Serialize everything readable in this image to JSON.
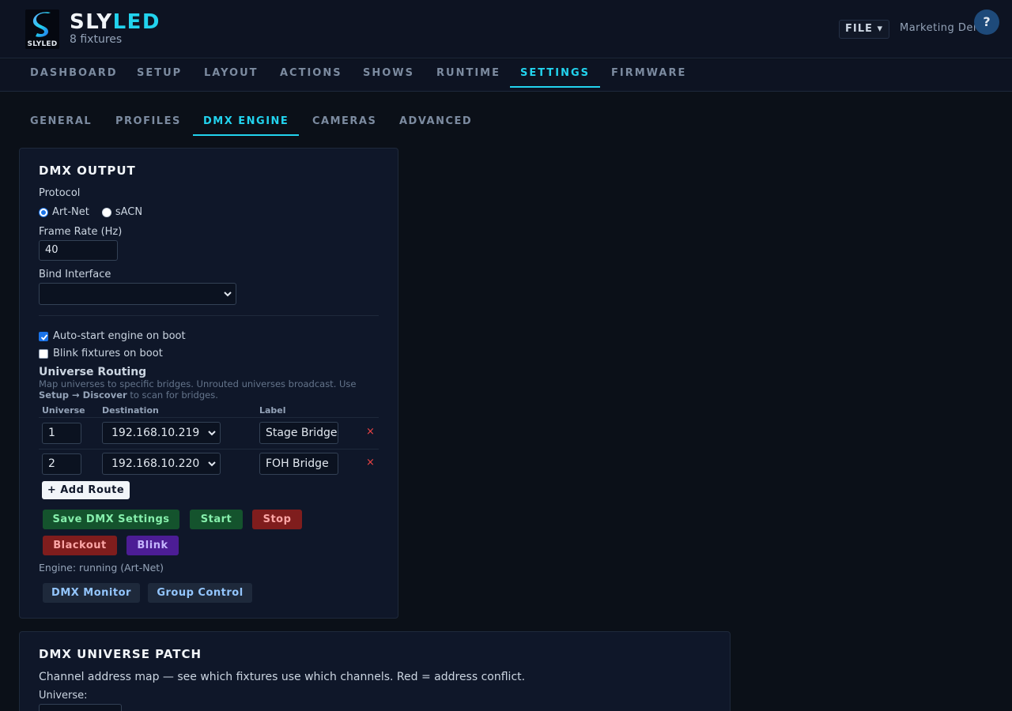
{
  "app": {
    "brand_part1": "SLY",
    "brand_part2": "LED",
    "logo_text": "SLYLED",
    "fixture_count": "8 fixtures",
    "file_label": "FILE ▾",
    "project_name": "Marketing Demo",
    "help_label": "?"
  },
  "colors": {
    "accent": "#22d3ee",
    "background": "#0b1018",
    "card": "#0f1729"
  },
  "main_nav": {
    "tabs": [
      {
        "label": "DASHBOARD",
        "active": false
      },
      {
        "label": "SETUP",
        "active": false
      },
      {
        "label": "LAYOUT",
        "active": false
      },
      {
        "label": "ACTIONS",
        "active": false
      },
      {
        "label": "SHOWS",
        "active": false
      },
      {
        "label": "RUNTIME",
        "active": false
      },
      {
        "label": "SETTINGS",
        "active": true
      },
      {
        "label": "FIRMWARE",
        "active": false
      }
    ]
  },
  "sub_nav": {
    "tabs": [
      {
        "label": "GENERAL",
        "active": false
      },
      {
        "label": "PROFILES",
        "active": false
      },
      {
        "label": "DMX ENGINE",
        "active": true
      },
      {
        "label": "CAMERAS",
        "active": false
      },
      {
        "label": "ADVANCED",
        "active": false
      }
    ]
  },
  "dmx_output": {
    "title": "DMX OUTPUT",
    "protocol_label": "Protocol",
    "protocol_options": [
      "Art-Net",
      "sACN"
    ],
    "protocol_selected": "Art-Net",
    "frame_rate_label": "Frame Rate (Hz)",
    "frame_rate_value": "40",
    "bind_interface_label": "Bind Interface",
    "bind_interface_value": "",
    "auto_start_label": "Auto-start engine on boot",
    "auto_start_checked": true,
    "blink_label": "Blink fixtures on boot",
    "blink_checked": false,
    "routing": {
      "title": "Universe Routing",
      "hint_line1": "Map universes to specific bridges. Unrouted universes broadcast. Use",
      "hint_setup": "Setup",
      "hint_arrow": " → ",
      "hint_discover": "Discover",
      "hint_end": " to scan for bridges.",
      "headers": {
        "universe": "Universe",
        "destination": "Destination",
        "label": "Label"
      },
      "rows": [
        {
          "universe": "1",
          "destination": "192.168.10.219",
          "label": "Stage Bridge"
        },
        {
          "universe": "2",
          "destination": "192.168.10.220",
          "label": "FOH Bridge"
        }
      ],
      "delete_symbol": "×",
      "add_route_label": "+ Add Route"
    },
    "buttons": {
      "save": "Save DMX Settings",
      "start": "Start",
      "stop": "Stop",
      "blackout": "Blackout",
      "blink": "Blink",
      "dmx_monitor": "DMX Monitor",
      "group_control": "Group Control"
    },
    "status": "Engine: running (Art-Net)"
  },
  "patch": {
    "title": "DMX UNIVERSE PATCH",
    "description": "Channel address map — see which fixtures use which channels. Red = address conflict.",
    "universe_label": "Universe:"
  },
  "icons": {
    "logo": "slyled-s-logo-icon",
    "chevron": "chevron-down-icon",
    "checkmark": "checkmark-icon",
    "delete": "close-icon"
  }
}
